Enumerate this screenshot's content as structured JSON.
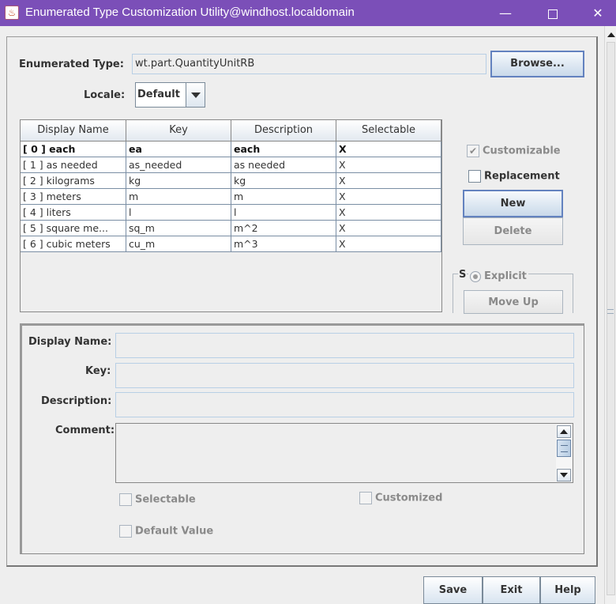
{
  "window": {
    "title": "Enumerated Type Customization Utility@windhost.localdomain",
    "minimize": "—",
    "close": "✕"
  },
  "header": {
    "enum_type_label": "Enumerated Type:",
    "enum_type_value": "wt.part.QuantityUnitRB",
    "browse_label": "Browse...",
    "locale_label": "Locale:",
    "locale_value": "Default"
  },
  "table": {
    "columns": [
      "Display Name",
      "Key",
      "Description",
      "Selectable"
    ],
    "rows": [
      {
        "display": "[ 0 ]  each",
        "key": "ea",
        "description": "each",
        "selectable": "X",
        "selected": true
      },
      {
        "display": "[ 1 ]  as needed",
        "key": "as_needed",
        "description": "as needed",
        "selectable": "X"
      },
      {
        "display": "[ 2 ]  kilograms",
        "key": "kg",
        "description": "kg",
        "selectable": "X"
      },
      {
        "display": "[ 3 ]  meters",
        "key": "m",
        "description": "m",
        "selectable": "X"
      },
      {
        "display": "[ 4 ]  liters",
        "key": "l",
        "description": "l",
        "selectable": "X"
      },
      {
        "display": "[ 5 ]  square me...",
        "key": "sq_m",
        "description": "m^2",
        "selectable": "X"
      },
      {
        "display": "[ 6 ]  cubic meters",
        "key": "cu_m",
        "description": "m^3",
        "selectable": "X"
      }
    ]
  },
  "side": {
    "customizable_label": "Customizable",
    "customizable_mark": "✔",
    "replacement_label": "Replacement",
    "new_label": "New",
    "delete_label": "Delete",
    "sort_group_title": "S",
    "explicit_label": "Explicit",
    "move_up_label": "Move Up"
  },
  "detail": {
    "display_name_label": "Display Name:",
    "key_label": "Key:",
    "description_label": "Description:",
    "comment_label": "Comment:",
    "selectable_label": "Selectable",
    "customized_label": "Customized",
    "default_value_label": "Default Value"
  },
  "footer": {
    "save_label": "Save",
    "exit_label": "Exit",
    "help_label": "Help"
  }
}
